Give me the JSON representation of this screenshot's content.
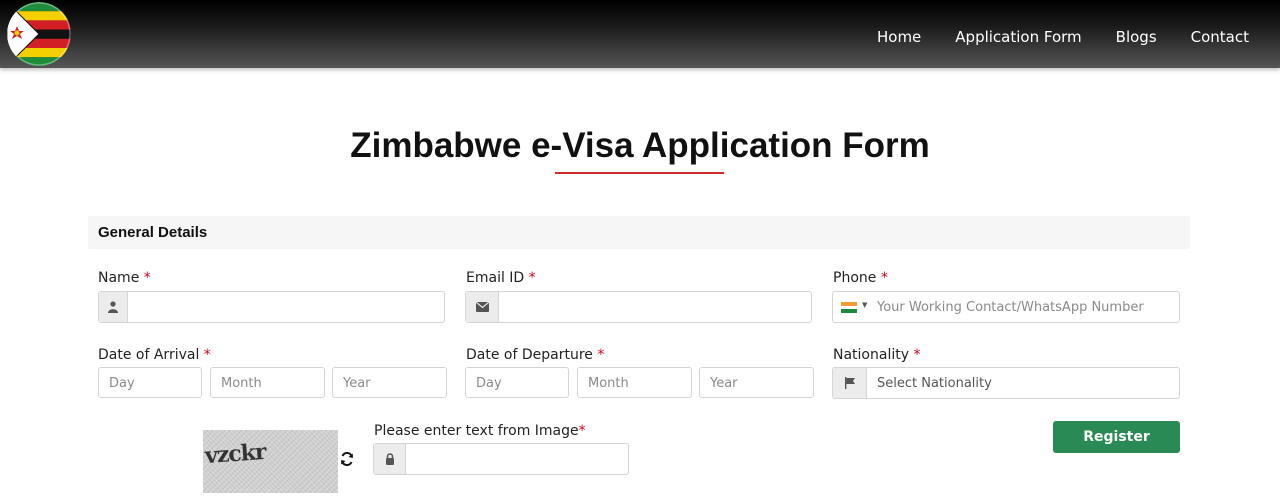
{
  "nav": {
    "items": [
      "Home",
      "Application Form",
      "Blogs",
      "Contact"
    ]
  },
  "title": "Zimbabwe e-Visa Application Form",
  "section": {
    "title": "General Details"
  },
  "fields": {
    "name_label": "Name",
    "email_label": "Email ID",
    "phone_label": "Phone",
    "phone_placeholder": "Your Working Contact/WhatsApp Number",
    "arrival_label": "Date of Arrival",
    "departure_label": "Date of Departure",
    "nationality_label": "Nationality",
    "nationality_placeholder": "Select Nationality",
    "date_parts": {
      "day": "Day",
      "month": "Month",
      "year": "Year"
    },
    "required_mark": "*"
  },
  "captcha": {
    "text": "vzckr",
    "label": "Please enter text from Image",
    "required_mark": "*"
  },
  "register_label": "Register",
  "colors": {
    "accent_red": "#d62828",
    "button_green": "#2a8a55",
    "section_bg": "#f6f6f6"
  },
  "icons": {
    "name": "user-icon",
    "email": "envelope-icon",
    "phone": "india-flag-icon",
    "nationality": "flag-icon",
    "captcha_input": "lock-icon",
    "refresh": "refresh-icon"
  }
}
